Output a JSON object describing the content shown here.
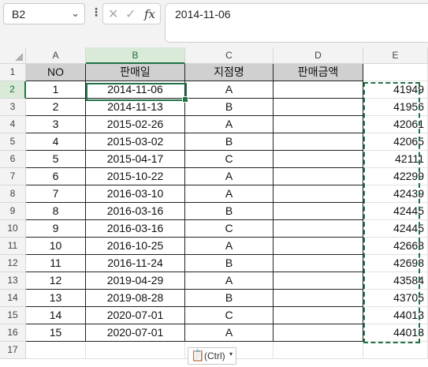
{
  "formula_bar": {
    "name_box": "B2",
    "cancel_icon": "✕",
    "enter_icon": "✓",
    "fx_label": "fx",
    "formula_value": "2014-11-06"
  },
  "sheet": {
    "columns": [
      "A",
      "B",
      "C",
      "D",
      "E"
    ],
    "rows": [
      "1",
      "2",
      "3",
      "4",
      "5",
      "6",
      "7",
      "8",
      "9",
      "10",
      "11",
      "12",
      "13",
      "14",
      "15",
      "16",
      "17"
    ],
    "header_row": [
      "NO",
      "판매일",
      "지점명",
      "판매금액",
      ""
    ],
    "data_rows": [
      [
        "1",
        "2014-11-06",
        "A",
        "",
        "41949"
      ],
      [
        "2",
        "2014-11-13",
        "B",
        "",
        "41956"
      ],
      [
        "3",
        "2015-02-26",
        "A",
        "",
        "42061"
      ],
      [
        "4",
        "2015-03-02",
        "B",
        "",
        "42065"
      ],
      [
        "5",
        "2015-04-17",
        "C",
        "",
        "42111"
      ],
      [
        "6",
        "2015-10-22",
        "A",
        "",
        "42299"
      ],
      [
        "7",
        "2016-03-10",
        "A",
        "",
        "42439"
      ],
      [
        "8",
        "2016-03-16",
        "B",
        "",
        "42445"
      ],
      [
        "9",
        "2016-03-16",
        "C",
        "",
        "42445"
      ],
      [
        "10",
        "2016-10-25",
        "A",
        "",
        "42668"
      ],
      [
        "11",
        "2016-11-24",
        "B",
        "",
        "42698"
      ],
      [
        "12",
        "2019-04-29",
        "A",
        "",
        "43584"
      ],
      [
        "13",
        "2019-08-28",
        "B",
        "",
        "43705"
      ],
      [
        "14",
        "2020-07-01",
        "C",
        "",
        "44013"
      ],
      [
        "15",
        "2020-07-01",
        "A",
        "",
        "44013"
      ]
    ],
    "active_cell": "B2",
    "accent_color": "#217346"
  },
  "paste_options": {
    "label": "(Ctrl)",
    "icon": "clipboard-icon",
    "chevron": "▾"
  }
}
